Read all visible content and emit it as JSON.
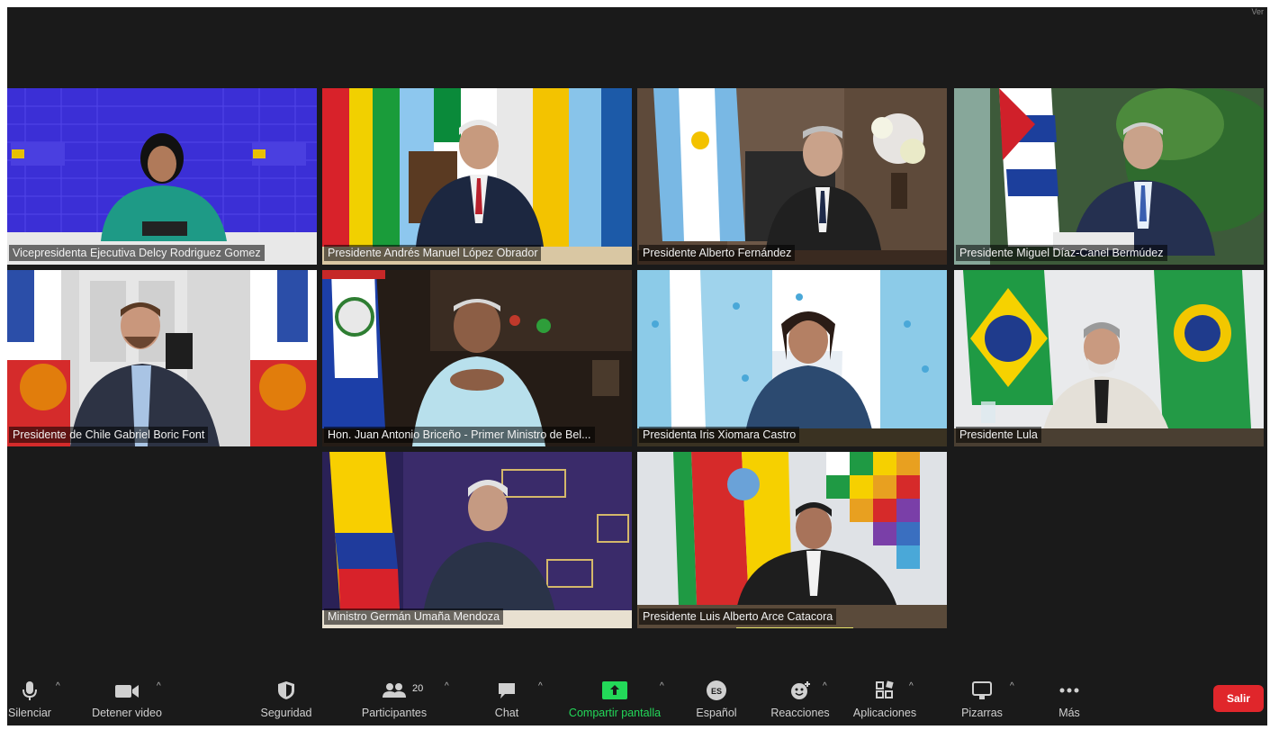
{
  "window": {
    "view_label": "Ver"
  },
  "participants": [
    {
      "name": "Vicepresidenta Ejecutiva Delcy Rodriguez Gomez"
    },
    {
      "name": "Presidente Andrés Manuel López Obrador"
    },
    {
      "name": "Presidente Alberto Fernández"
    },
    {
      "name": "Presidente Miguel Díaz-Canel Bermúdez"
    },
    {
      "name": "Presidente de Chile Gabriel Boric Font"
    },
    {
      "name": "Hon. Juan Antonio Briceño - Primer Ministro de Bel..."
    },
    {
      "name": "Presidenta Iris Xiomara Castro"
    },
    {
      "name": "Presidente Lula"
    },
    {
      "name": "Ministro Germán Umaña Mendoza"
    },
    {
      "name": "Presidente Luis Alberto Arce Catacora"
    }
  ],
  "toolbar": {
    "mute_label": "Silenciar",
    "video_label": "Detener video",
    "security_label": "Seguridad",
    "participants_label": "Participantes",
    "participants_count": "20",
    "chat_label": "Chat",
    "share_label": "Compartir pantalla",
    "language_label": "Español",
    "language_code": "ES",
    "reactions_label": "Reacciones",
    "apps_label": "Aplicaciones",
    "whiteboard_label": "Pizarras",
    "more_label": "Más",
    "leave_label": "Salir"
  },
  "colors": {
    "background": "#1a1a1a",
    "speaking_border": "#e7e36a",
    "share_green": "#23d959",
    "leave_red": "#e0262b"
  }
}
